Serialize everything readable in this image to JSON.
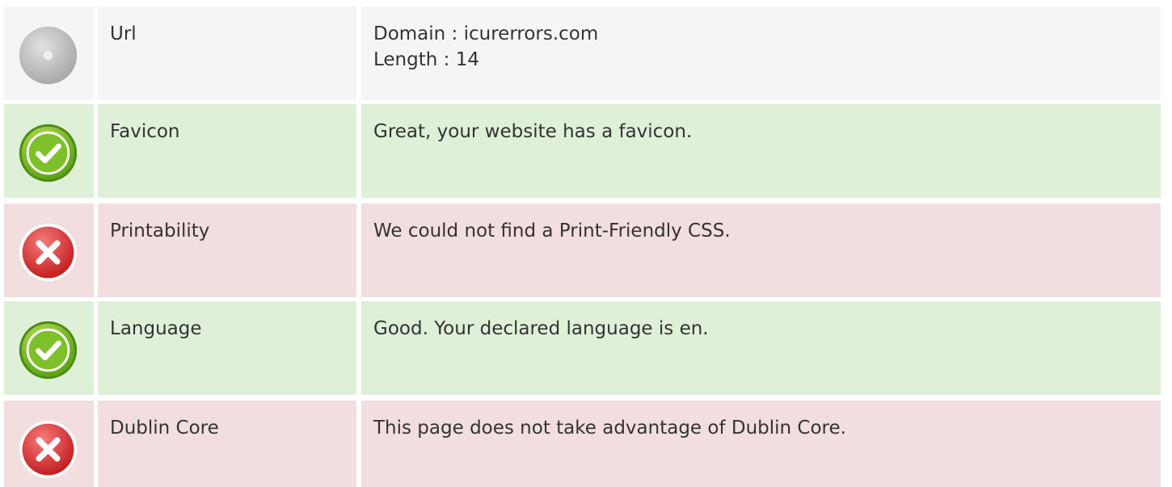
{
  "rows": [
    {
      "status": "neutral",
      "icon": "neutral-disc-icon",
      "label": "Url",
      "values": [
        "Domain : icurerrors.com",
        "Length : 14"
      ]
    },
    {
      "status": "good",
      "icon": "check-icon",
      "label": "Favicon",
      "values": [
        "Great, your website has a favicon."
      ]
    },
    {
      "status": "bad",
      "icon": "cross-icon",
      "label": "Printability",
      "values": [
        "We could not find a Print-Friendly CSS."
      ]
    },
    {
      "status": "good",
      "icon": "check-icon",
      "label": "Language",
      "values": [
        "Good. Your declared language is en."
      ]
    },
    {
      "status": "bad",
      "icon": "cross-icon",
      "label": "Dublin Core",
      "values": [
        "This page does not take advantage of Dublin Core."
      ]
    }
  ],
  "colors": {
    "neutral_bg": "#f5f5f5",
    "good_bg": "#dff0d8",
    "bad_bg": "#f2dede",
    "good_icon": "#7cc22a",
    "bad_icon": "#e03a3a",
    "neutral_icon": "#bdbdbd"
  }
}
